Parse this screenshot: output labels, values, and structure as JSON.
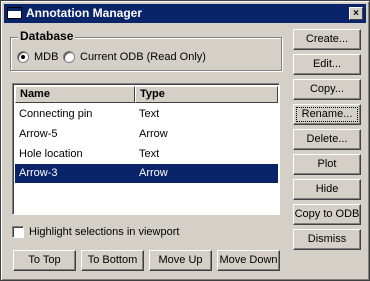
{
  "window": {
    "title": "Annotation Manager",
    "close_label": "×"
  },
  "database": {
    "legend": "Database",
    "options": [
      {
        "label": "MDB",
        "selected": true
      },
      {
        "label": "Current ODB (Read Only)",
        "selected": false
      }
    ]
  },
  "list": {
    "columns": [
      "Name",
      "Type"
    ],
    "rows": [
      {
        "name": "Connecting pin",
        "type": "Text",
        "selected": false
      },
      {
        "name": "Arrow-5",
        "type": "Arrow",
        "selected": false
      },
      {
        "name": "Hole location",
        "type": "Text",
        "selected": false
      },
      {
        "name": "Arrow-3",
        "type": "Arrow",
        "selected": true
      }
    ]
  },
  "highlight": {
    "label": "Highlight selections in viewport",
    "checked": false
  },
  "side_buttons": {
    "create": "Create...",
    "edit": "Edit...",
    "copy": "Copy...",
    "rename": "Rename...",
    "delete": "Delete...",
    "plot": "Plot",
    "hide": "Hide",
    "copy_to_odb": "Copy to ODB",
    "dismiss": "Dismiss"
  },
  "bottom_buttons": {
    "to_top": "To Top",
    "to_bottom": "To Bottom",
    "move_up": "Move Up",
    "move_down": "Move Down"
  },
  "colors": {
    "window_bg": "#d4d0c8",
    "titlebar": "#0a246a",
    "selection": "#0a246a"
  }
}
